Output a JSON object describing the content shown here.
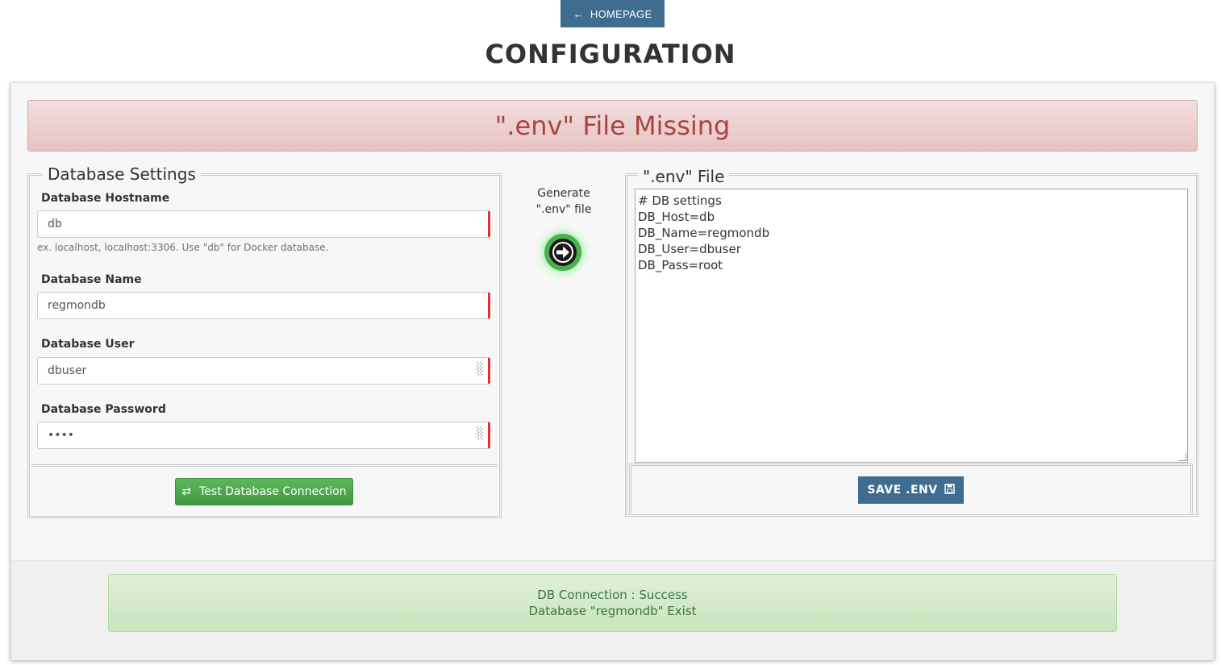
{
  "header": {
    "home_button_label": "HOMEPAGE",
    "home_icon": "arrow-left-icon",
    "title": "CONFIGURATION"
  },
  "alert_error": {
    "message": "\".env\" File Missing",
    "color": "#a94442"
  },
  "database_settings": {
    "legend": "Database Settings",
    "hostname_label": "Database Hostname",
    "hostname_value": "db",
    "hostname_help": "ex. localhost, localhost:3306. Use \"db\" for Docker database.",
    "name_label": "Database Name",
    "name_value": "regmondb",
    "user_label": "Database User",
    "user_value": "dbuser",
    "password_label": "Database Password",
    "password_value": "root",
    "test_button_label": "Test Database Connection",
    "test_button_icon": "exchange-icon"
  },
  "generate": {
    "line1": "Generate",
    "line2": "\".env\" file",
    "icon": "arrow-circle-right-icon"
  },
  "env_file": {
    "legend": "\".env\" File",
    "content": "# DB settings\nDB_Host=db\nDB_Name=regmondb\nDB_User=dbuser\nDB_Pass=root",
    "save_button_label": "SAVE .ENV",
    "save_icon": "floppy-disk-icon"
  },
  "alert_success": {
    "line1": "DB Connection : Success",
    "line2": "Database \"regmondb\" Exist",
    "color": "#3c763d"
  },
  "colors": {
    "primary": "#3f6d8f",
    "success": "#4cae4c",
    "danger_border": "#e03131"
  }
}
